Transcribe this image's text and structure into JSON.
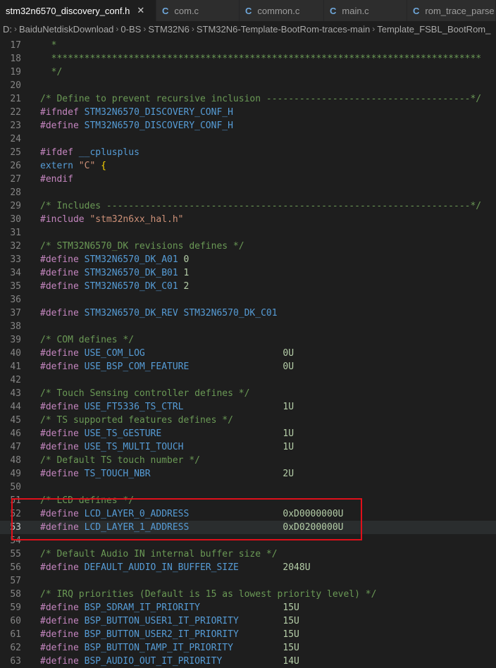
{
  "tabs": [
    {
      "icon": "C",
      "label": "stm32n6570_discovery_conf.h",
      "active": true,
      "close": "✕"
    },
    {
      "icon": "C",
      "label": "com.c",
      "active": false
    },
    {
      "icon": "C",
      "label": "common.c",
      "active": false
    },
    {
      "icon": "C",
      "label": "main.c",
      "active": false
    },
    {
      "icon": "C",
      "label": "rom_trace_parse",
      "active": false
    }
  ],
  "breadcrumb": [
    "D:",
    "BaiduNetdiskDownload",
    "0-BS",
    "STM32N6",
    "STM32N6-Template-BootRom-traces-main",
    "Template_FSBL_BootRom_"
  ],
  "lines": [
    {
      "n": "17",
      "t": [
        [
          "  *",
          "comment"
        ]
      ]
    },
    {
      "n": "18",
      "t": [
        [
          "  ******************************************************************************",
          "comment"
        ]
      ]
    },
    {
      "n": "19",
      "t": [
        [
          "  */",
          "comment"
        ]
      ]
    },
    {
      "n": "20",
      "t": []
    },
    {
      "n": "21",
      "t": [
        [
          "/* Define to prevent recursive inclusion -------------------------------------*/",
          "comment"
        ]
      ]
    },
    {
      "n": "22",
      "t": [
        [
          "#ifndef ",
          "pp"
        ],
        [
          "STM32N6570_DISCOVERY_CONF_H",
          "macro"
        ]
      ]
    },
    {
      "n": "23",
      "t": [
        [
          "#define ",
          "pp"
        ],
        [
          "STM32N6570_DISCOVERY_CONF_H",
          "macro"
        ]
      ]
    },
    {
      "n": "24",
      "t": []
    },
    {
      "n": "25",
      "t": [
        [
          "#ifdef ",
          "pp"
        ],
        [
          "__cplusplus",
          "macro"
        ]
      ]
    },
    {
      "n": "26",
      "t": [
        [
          "extern ",
          "kw"
        ],
        [
          "\"C\"",
          "str"
        ],
        [
          " {",
          "brace"
        ]
      ]
    },
    {
      "n": "27",
      "t": [
        [
          "#endif",
          "pp"
        ]
      ]
    },
    {
      "n": "28",
      "t": []
    },
    {
      "n": "29",
      "t": [
        [
          "/* Includes ------------------------------------------------------------------*/",
          "comment"
        ]
      ]
    },
    {
      "n": "30",
      "t": [
        [
          "#include ",
          "pp"
        ],
        [
          "\"stm32n6xx_hal.h\"",
          "str"
        ]
      ]
    },
    {
      "n": "31",
      "t": []
    },
    {
      "n": "32",
      "t": [
        [
          "/* STM32N6570_DK revisions defines */",
          "comment"
        ]
      ]
    },
    {
      "n": "33",
      "t": [
        [
          "#define ",
          "pp"
        ],
        [
          "STM32N6570_DK_A01",
          "macro"
        ],
        [
          " 0",
          "num"
        ]
      ]
    },
    {
      "n": "34",
      "t": [
        [
          "#define ",
          "pp"
        ],
        [
          "STM32N6570_DK_B01",
          "macro"
        ],
        [
          " 1",
          "num"
        ]
      ]
    },
    {
      "n": "35",
      "t": [
        [
          "#define ",
          "pp"
        ],
        [
          "STM32N6570_DK_C01",
          "macro"
        ],
        [
          " 2",
          "num"
        ]
      ]
    },
    {
      "n": "36",
      "t": []
    },
    {
      "n": "37",
      "t": [
        [
          "#define ",
          "pp"
        ],
        [
          "STM32N6570_DK_REV STM32N6570_DK_C01",
          "macro"
        ]
      ]
    },
    {
      "n": "38",
      "t": []
    },
    {
      "n": "39",
      "t": [
        [
          "/* COM defines */",
          "comment"
        ]
      ]
    },
    {
      "n": "40",
      "t": [
        [
          "#define ",
          "pp"
        ],
        [
          "USE_COM_LOG                         ",
          "macro"
        ],
        [
          "0U",
          "num"
        ]
      ]
    },
    {
      "n": "41",
      "t": [
        [
          "#define ",
          "pp"
        ],
        [
          "USE_BSP_COM_FEATURE                 ",
          "macro"
        ],
        [
          "0U",
          "num"
        ]
      ]
    },
    {
      "n": "42",
      "t": []
    },
    {
      "n": "43",
      "t": [
        [
          "/* Touch Sensing controller defines */",
          "comment"
        ]
      ]
    },
    {
      "n": "44",
      "t": [
        [
          "#define ",
          "pp"
        ],
        [
          "USE_FT5336_TS_CTRL                  ",
          "macro"
        ],
        [
          "1U",
          "num"
        ]
      ]
    },
    {
      "n": "45",
      "t": [
        [
          "/* TS supported features defines */",
          "comment"
        ]
      ]
    },
    {
      "n": "46",
      "t": [
        [
          "#define ",
          "pp"
        ],
        [
          "USE_TS_GESTURE                      ",
          "macro"
        ],
        [
          "1U",
          "num"
        ]
      ]
    },
    {
      "n": "47",
      "t": [
        [
          "#define ",
          "pp"
        ],
        [
          "USE_TS_MULTI_TOUCH                  ",
          "macro"
        ],
        [
          "1U",
          "num"
        ]
      ]
    },
    {
      "n": "48",
      "t": [
        [
          "/* Default TS touch number */",
          "comment"
        ]
      ]
    },
    {
      "n": "49",
      "t": [
        [
          "#define ",
          "pp"
        ],
        [
          "TS_TOUCH_NBR                        ",
          "macro"
        ],
        [
          "2U",
          "num"
        ]
      ]
    },
    {
      "n": "50",
      "t": []
    },
    {
      "n": "51",
      "t": [
        [
          "/* LCD defines */",
          "comment"
        ]
      ]
    },
    {
      "n": "52",
      "t": [
        [
          "#define ",
          "pp"
        ],
        [
          "LCD_LAYER_0_ADDRESS                 ",
          "macro"
        ],
        [
          "0xD0000000U",
          "num"
        ]
      ]
    },
    {
      "n": "53",
      "t": [
        [
          "#define ",
          "pp"
        ],
        [
          "LCD_LAYER_1_ADDRESS                 ",
          "macro"
        ],
        [
          "0xD0200000U",
          "num"
        ]
      ],
      "current": true
    },
    {
      "n": "54",
      "t": []
    },
    {
      "n": "55",
      "t": [
        [
          "/* Default Audio IN internal buffer size */",
          "comment"
        ]
      ]
    },
    {
      "n": "56",
      "t": [
        [
          "#define ",
          "pp"
        ],
        [
          "DEFAULT_AUDIO_IN_BUFFER_SIZE        ",
          "macro"
        ],
        [
          "2048U",
          "num"
        ]
      ]
    },
    {
      "n": "57",
      "t": []
    },
    {
      "n": "58",
      "t": [
        [
          "/* IRQ priorities (Default is 15 as lowest priority level) */",
          "comment"
        ]
      ]
    },
    {
      "n": "59",
      "t": [
        [
          "#define ",
          "pp"
        ],
        [
          "BSP_SDRAM_IT_PRIORITY               ",
          "macro"
        ],
        [
          "15U",
          "num"
        ]
      ]
    },
    {
      "n": "60",
      "t": [
        [
          "#define ",
          "pp"
        ],
        [
          "BSP_BUTTON_USER1_IT_PRIORITY        ",
          "macro"
        ],
        [
          "15U",
          "num"
        ]
      ]
    },
    {
      "n": "61",
      "t": [
        [
          "#define ",
          "pp"
        ],
        [
          "BSP_BUTTON_USER2_IT_PRIORITY        ",
          "macro"
        ],
        [
          "15U",
          "num"
        ]
      ]
    },
    {
      "n": "62",
      "t": [
        [
          "#define ",
          "pp"
        ],
        [
          "BSP_BUTTON_TAMP_IT_PRIORITY         ",
          "macro"
        ],
        [
          "15U",
          "num"
        ]
      ]
    },
    {
      "n": "63",
      "t": [
        [
          "#define ",
          "pp"
        ],
        [
          "BSP_AUDIO_OUT_IT_PRIORITY           ",
          "macro"
        ],
        [
          "14U",
          "num"
        ]
      ]
    }
  ]
}
